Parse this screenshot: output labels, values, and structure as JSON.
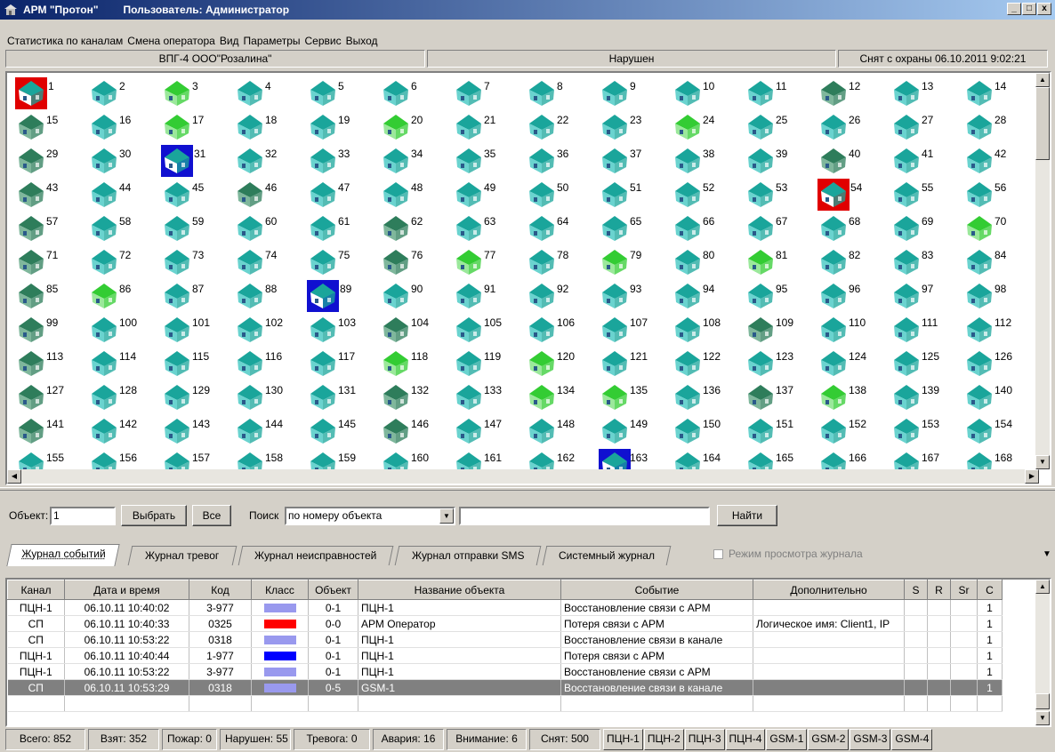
{
  "window": {
    "app_title": "АРМ \"Протон\"",
    "user_label": "Пользователь: Администратор",
    "min": "_",
    "max": "□",
    "close": "x"
  },
  "menu": [
    "Статистика по каналам",
    "Смена оператора",
    "Вид",
    "Параметры",
    "Сервис",
    "Выход"
  ],
  "status_row": {
    "object_name": "ВПГ-4 ООО\"Розалина\"",
    "state": "Нарушен",
    "disarm": "Снят с охраны 06.10.2011 9:02:21"
  },
  "colors": {
    "house_teal": "#1aa59b",
    "house_green": "#33cc33",
    "house_dark": "#2e7d5b",
    "sel_red": "#e00000",
    "sel_blue": "#1010d0",
    "class_lavender": "#9999ee",
    "class_red": "#ff0000",
    "class_blue": "#0000ff"
  },
  "objects": {
    "columns": 14,
    "first": 1,
    "last": 168,
    "green": [
      3,
      17,
      20,
      24,
      70,
      77,
      79,
      81,
      86,
      118,
      120,
      134,
      135,
      138
    ],
    "dark": [
      12,
      15,
      29,
      40,
      43,
      46,
      57,
      62,
      71,
      76,
      85,
      99,
      104,
      109,
      113,
      127,
      132,
      137,
      141,
      146
    ],
    "selected_red": [
      1,
      54
    ],
    "selected_blue": [
      31,
      89,
      163
    ]
  },
  "search": {
    "object_label": "Объект:",
    "object_value": "1",
    "select_btn": "Выбрать",
    "all_btn": "Все",
    "search_label": "Поиск",
    "search_mode": "по номеру объекта",
    "query": "",
    "find_btn": "Найти",
    "dd_arrow": "▼"
  },
  "tabs": [
    "Журнал событий",
    "Журнал тревог",
    "Журнал неисправностей",
    "Журнал отправки SMS",
    "Системный журнал"
  ],
  "view_mode_label": "Режим просмотра журнала",
  "table": {
    "headers": [
      "Канал",
      "Дата и время",
      "Код",
      "Класс",
      "Объект",
      "Название объекта",
      "Событие",
      "Дополнительно",
      "S",
      "R",
      "Sr",
      "C"
    ],
    "rows": [
      {
        "channel": "ПЦН-1",
        "datetime": "06.10.11   10:40:02",
        "code": "3-977",
        "cls": "#9999ee",
        "object": "0-1",
        "name": "ПЦН-1",
        "event": "Восстановление связи с АРМ",
        "extra": "",
        "s": "",
        "r": "",
        "sr": "",
        "c": "1"
      },
      {
        "channel": "СП",
        "datetime": "06.10.11   10:40:33",
        "code": "0325",
        "cls": "#ff0000",
        "object": "0-0",
        "name": "АРМ Оператор",
        "event": "Потеря связи с АРМ",
        "extra": "Логическое имя: Client1, IP",
        "s": "",
        "r": "",
        "sr": "",
        "c": "1"
      },
      {
        "channel": "СП",
        "datetime": "06.10.11   10:53:22",
        "code": "0318",
        "cls": "#9999ee",
        "object": "0-1",
        "name": "ПЦН-1",
        "event": "Восстановление связи в канале",
        "extra": "",
        "s": "",
        "r": "",
        "sr": "",
        "c": "1"
      },
      {
        "channel": "ПЦН-1",
        "datetime": "06.10.11   10:40:44",
        "code": "1-977",
        "cls": "#0000ff",
        "object": "0-1",
        "name": "ПЦН-1",
        "event": "Потеря связи с АРМ",
        "extra": "",
        "s": "",
        "r": "",
        "sr": "",
        "c": "1"
      },
      {
        "channel": "ПЦН-1",
        "datetime": "06.10.11   10:53:22",
        "code": "3-977",
        "cls": "#9999ee",
        "object": "0-1",
        "name": "ПЦН-1",
        "event": "Восстановление связи с АРМ",
        "extra": "",
        "s": "",
        "r": "",
        "sr": "",
        "c": "1"
      },
      {
        "channel": "СП",
        "datetime": "06.10.11   10:53:29",
        "code": "0318",
        "cls": "#9999ee",
        "object": "0-5",
        "name": "GSM-1",
        "event": "Восстановление связи в канале",
        "extra": "",
        "s": "",
        "r": "",
        "sr": "",
        "c": "1",
        "selected": true
      }
    ]
  },
  "footer": {
    "counts": [
      "Всего: 852",
      "Взят: 352",
      "Пожар: 0",
      "Нарушен: 55",
      "Тревога: 0",
      "Авария: 16",
      "Внимание: 6",
      "Снят: 500"
    ],
    "channels": [
      "ПЦН-1",
      "ПЦН-2",
      "ПЦН-3",
      "ПЦН-4",
      "GSM-1",
      "GSM-2",
      "GSM-3",
      "GSM-4"
    ]
  }
}
